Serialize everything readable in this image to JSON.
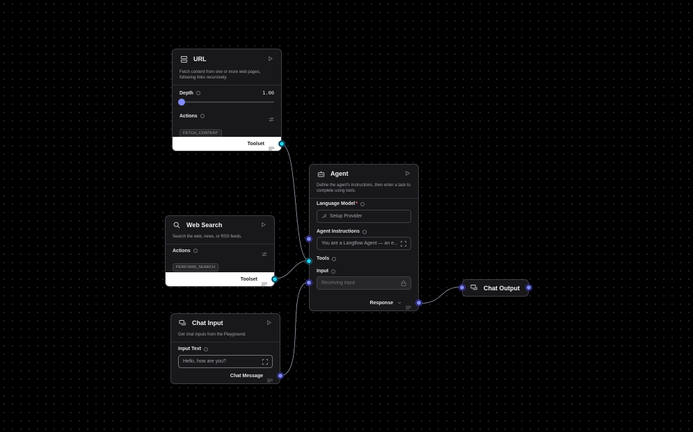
{
  "url_node": {
    "title": "URL",
    "description": "Fetch content from one or more web pages, following links recursively.",
    "depth_label": "Depth",
    "depth_value": "1.00",
    "actions_label": "Actions",
    "action_badge": "FETCH_CONTENT",
    "output_label": "Toolset"
  },
  "web_search_node": {
    "title": "Web Search",
    "description": "Search the web, news, or RSS feeds.",
    "actions_label": "Actions",
    "action_badge": "PERFORM_SEARCH",
    "output_label": "Toolset"
  },
  "chat_input_node": {
    "title": "Chat Input",
    "description": "Get chat inputs from the Playground.",
    "input_text_label": "Input Text",
    "input_text_value": "Hello, how are you?",
    "output_label": "Chat Message"
  },
  "agent_node": {
    "title": "Agent",
    "description": "Define the agent's instructions, then enter a task to complete using tools.",
    "language_model_label": "Language Model",
    "required_mark": "*",
    "setup_provider": "Setup Provider",
    "agent_instructions_label": "Agent Instructions",
    "agent_instructions_value": "You are a Langflow Agent — an e...",
    "tools_label": "Tools",
    "input_label": "Input",
    "input_placeholder": "Receiving input",
    "output_label": "Response"
  },
  "chat_output_node": {
    "title": "Chat Output"
  },
  "colors": {
    "cyan_handle": "#22d3ee",
    "purple_handle": "#818cf8",
    "node_bg": "#18181b",
    "canvas_bg": "#000000"
  }
}
